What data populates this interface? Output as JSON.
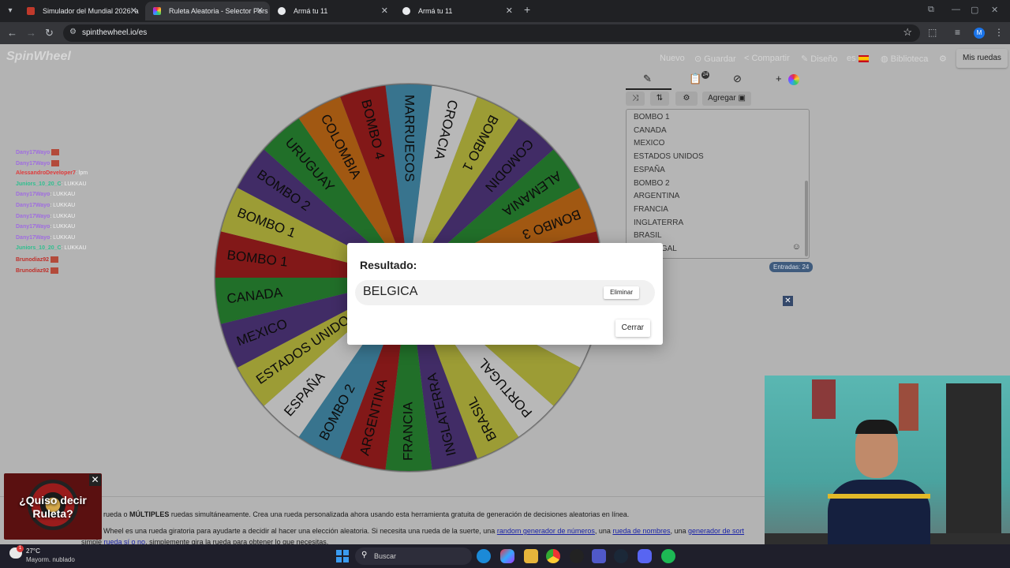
{
  "browser": {
    "tabs": [
      {
        "title": "Simulador del Mundial 2026: a",
        "active": false
      },
      {
        "title": "Ruleta Aleatoria - Selector Pers",
        "active": true
      },
      {
        "title": "Armá tu 11",
        "active": false
      },
      {
        "title": "Armá tu 11",
        "active": false
      }
    ],
    "url": "spinthewheel.io/es",
    "profile_initial": "M"
  },
  "site": {
    "logo": "SpinWheel",
    "nav": {
      "nuevo": "Nuevo",
      "guardar": "Guardar",
      "compartir": "Compartir",
      "diseno": "Diseño",
      "lang": "es",
      "biblioteca": "Biblioteca",
      "mis_ruedas": "Mis ruedas"
    }
  },
  "panel": {
    "add_label": "Agregar",
    "entries": [
      "BOMBO 1",
      "CANADA",
      "MEXICO",
      "ESTADOS UNIDOS",
      "ESPAÑA",
      "BOMBO 2",
      "ARGENTINA",
      "FRANCIA",
      "INGLATERRA",
      "BRASIL",
      "PORTUGAL"
    ],
    "count_label": "Entradas: 24",
    "badge": "24"
  },
  "wheel": {
    "segments": [
      {
        "label": "MARRUECOS",
        "color": "#4ea1c5"
      },
      {
        "label": "CROACIA",
        "color": "#ffffff"
      },
      {
        "label": "BOMBO 1",
        "color": "#d8d84a"
      },
      {
        "label": "COMODIN",
        "color": "#5b3e8e"
      },
      {
        "label": "ALEMANIA",
        "color": "#2e9a3a"
      },
      {
        "label": "BOMBO 3",
        "color": "#e07a1a"
      },
      {
        "label": "",
        "color": "#b52222"
      },
      {
        "label": "",
        "color": "#4ea1c5"
      },
      {
        "label": "",
        "color": "#ffffff"
      },
      {
        "label": "",
        "color": "#d8d84a"
      },
      {
        "label": "PORTUGAL",
        "color": "#ffffff"
      },
      {
        "label": "BRASIL",
        "color": "#d8d84a"
      },
      {
        "label": "INGLATERRA",
        "color": "#5b3e8e"
      },
      {
        "label": "FRANCIA",
        "color": "#2e9a3a"
      },
      {
        "label": "ARGENTINA",
        "color": "#b52222"
      },
      {
        "label": "BOMBO 2",
        "color": "#4ea1c5"
      },
      {
        "label": "ESPAÑA",
        "color": "#ffffff"
      },
      {
        "label": "ESTADOS UNIDOS",
        "color": "#d8d84a"
      },
      {
        "label": "MEXICO",
        "color": "#5b3e8e"
      },
      {
        "label": "CANADA",
        "color": "#2e9a3a"
      },
      {
        "label": "BOMBO 1",
        "color": "#b52222"
      },
      {
        "label": "BOMBO 1",
        "color": "#d8d84a"
      },
      {
        "label": "BOMBO 2",
        "color": "#5b3e8e"
      },
      {
        "label": "URUGUAY",
        "color": "#2e9a3a"
      },
      {
        "label": "COLOMBIA",
        "color": "#e07a1a"
      },
      {
        "label": "BOMBO 4",
        "color": "#b52222"
      }
    ]
  },
  "chat": [
    {
      "user": "Dany17Wayo",
      "msg": "",
      "color": "#a06de0",
      "badge": true
    },
    {
      "user": "Dany17Wayo",
      "msg": "",
      "color": "#a06de0",
      "badge": true
    },
    {
      "user": "AlessandroDeveloper7",
      "msg": "lpm",
      "color": "#e03a3a",
      "badge": false
    },
    {
      "user": "Juniors_10_20_C",
      "msg": "LUKKAU",
      "color": "#2fbf8f",
      "badge": false
    },
    {
      "user": "Dany17Wayo",
      "msg": "LUKKAU",
      "color": "#a06de0",
      "badge": false
    },
    {
      "user": "Dany17Wayo",
      "msg": "LUKKAU",
      "color": "#a06de0",
      "badge": false
    },
    {
      "user": "Dany17Wayo",
      "msg": "LUKKAU",
      "color": "#a06de0",
      "badge": false
    },
    {
      "user": "Dany17Wayo",
      "msg": "LUKKAU",
      "color": "#a06de0",
      "badge": false
    },
    {
      "user": "Dany17Wayo",
      "msg": "LUKKAU",
      "color": "#a06de0",
      "badge": false
    },
    {
      "user": "Juniors_10_20_C",
      "msg": "LUKKAU",
      "color": "#2fbf8f",
      "badge": false
    },
    {
      "user": "Brunodiaz92",
      "msg": "",
      "color": "#c0302a",
      "badge": true
    },
    {
      "user": "Brunodiaz92",
      "msg": "",
      "color": "#c0302a",
      "badge": true
    }
  ],
  "modal": {
    "title": "Resultado:",
    "result": "BELGICA",
    "remove_label": "Eliminar",
    "close_label": "Cerrar"
  },
  "description": {
    "line1_pre": "rueda o ",
    "line1_bold": "MÚLTIPLES",
    "line1_post": " ruedas simultáneamente. Crea una rueda personalizada ahora usando esta herramienta gratuita de generación de decisiones aleatorias en línea.",
    "line2_pre": "Wheel es una rueda giratoria para ayudarte a decidir al hacer una elección aleatoria. Si necesita una rueda de la suerte, una ",
    "link1": "random generador de números",
    "line2_mid": ", una ",
    "link2": "rueda de nombres",
    "line2_mid2": ", una ",
    "link3": "generador de sort",
    "line3_pre": "simple ",
    "link4": "rueda sí o no",
    "line3_post": ", simplemente gira la rueda para obtener lo que necesitas."
  },
  "ad": {
    "text": "¿Quiso decir Ruleta?"
  },
  "taskbar": {
    "temperature": "27°C",
    "condition": "Mayorm. nublado",
    "weather_badge": "1",
    "search_label": "Buscar"
  }
}
